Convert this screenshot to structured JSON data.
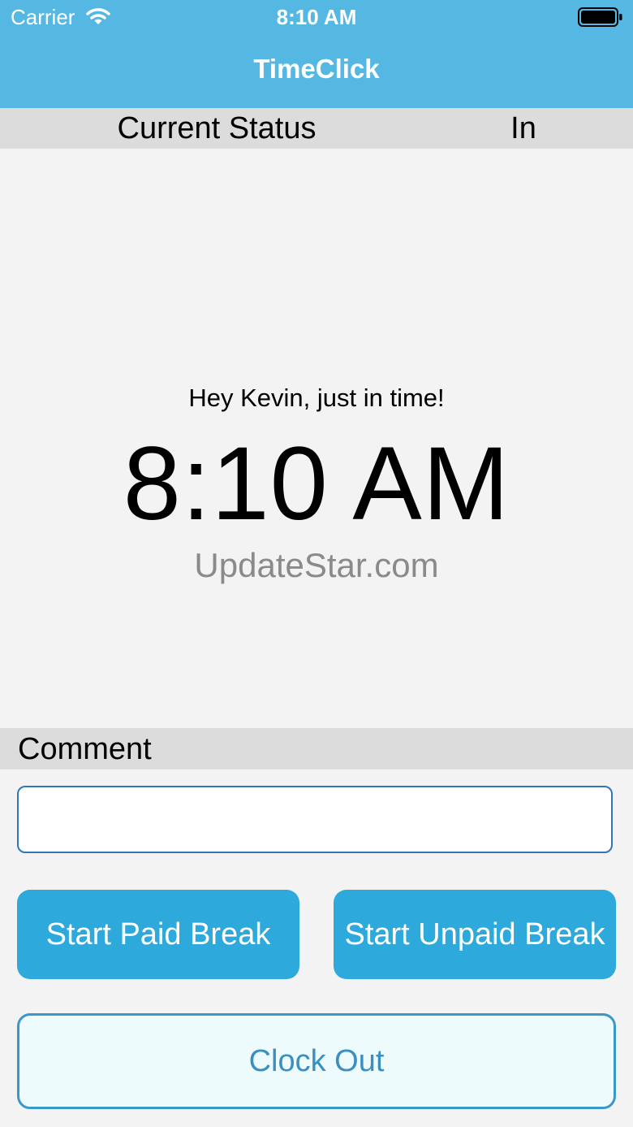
{
  "status_bar": {
    "carrier": "Carrier",
    "time": "8:10 AM"
  },
  "nav": {
    "title": "TimeClick"
  },
  "status": {
    "label": "Current Status",
    "value": "In"
  },
  "main": {
    "greeting": "Hey Kevin, just in time!",
    "time": "8:10 AM",
    "watermark": "UpdateStar.com"
  },
  "comment": {
    "label": "Comment",
    "value": "",
    "placeholder": ""
  },
  "buttons": {
    "paid_break": "Start Paid Break",
    "unpaid_break": "Start Unpaid Break",
    "clock_out": "Clock Out"
  },
  "colors": {
    "header": "#55b8e3",
    "button_blue": "#2ea9db",
    "clock_out_border": "#3a98c9"
  },
  "icons": [
    "wifi-icon",
    "battery-icon"
  ]
}
